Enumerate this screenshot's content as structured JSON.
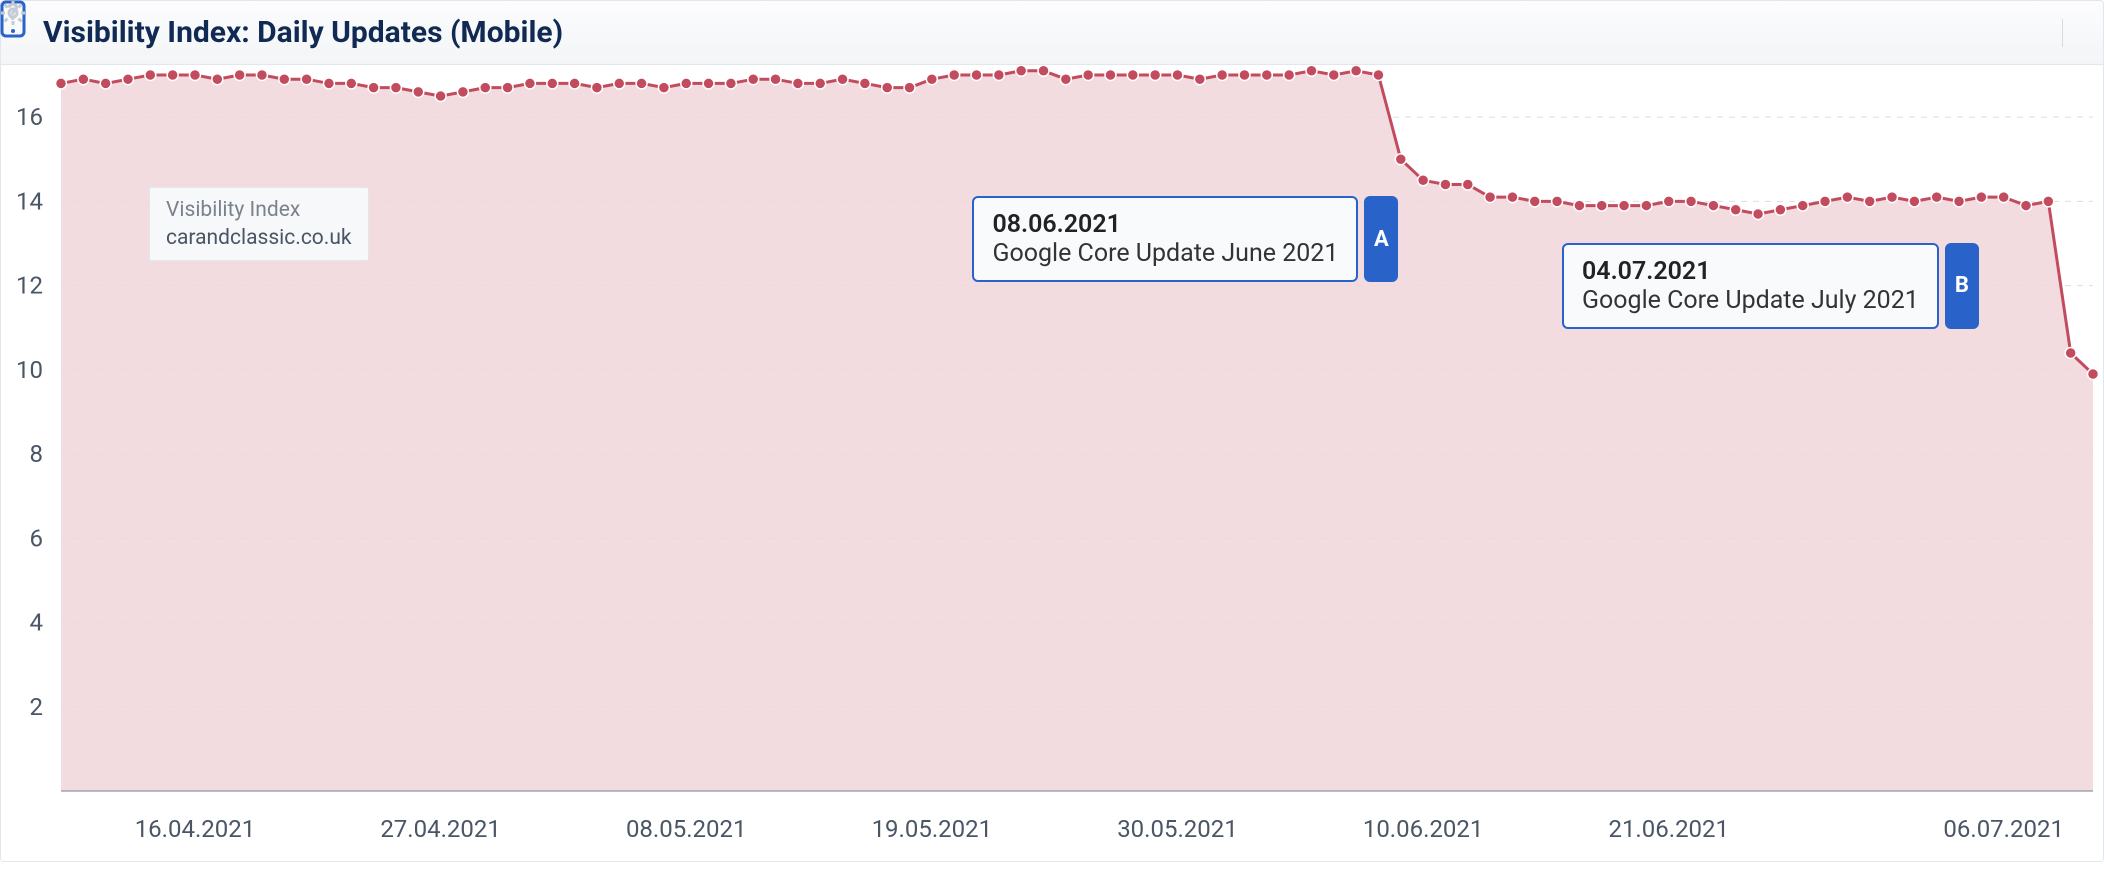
{
  "header": {
    "title": "Visibility Index: Daily Updates (Mobile)"
  },
  "legend": {
    "title": "Visibility Index",
    "domain": "carandclassic.co.uk"
  },
  "annotations": {
    "a": {
      "date": "08.06.2021",
      "text": "Google Core Update June 2021",
      "badge": "A"
    },
    "b": {
      "date": "04.07.2021",
      "text": "Google Core Update July 2021",
      "badge": "B"
    }
  },
  "chart_data": {
    "type": "area",
    "title": "Visibility Index: Daily Updates (Mobile)",
    "ylabel": "",
    "xlabel": "",
    "ylim": [
      0,
      17
    ],
    "y_ticks": [
      2,
      4,
      6,
      8,
      10,
      12,
      14,
      16
    ],
    "x_tick_labels": [
      "16.04.2021",
      "27.04.2021",
      "08.05.2021",
      "19.05.2021",
      "30.05.2021",
      "10.06.2021",
      "21.06.2021",
      "06.07.2021"
    ],
    "series": [
      {
        "name": "carandclassic.co.uk",
        "color": "#c24b5e",
        "fill": "#f0d6da",
        "x": [
          "10.04.2021",
          "11.04.2021",
          "12.04.2021",
          "13.04.2021",
          "14.04.2021",
          "15.04.2021",
          "16.04.2021",
          "17.04.2021",
          "18.04.2021",
          "19.04.2021",
          "20.04.2021",
          "21.04.2021",
          "22.04.2021",
          "23.04.2021",
          "24.04.2021",
          "25.04.2021",
          "26.04.2021",
          "27.04.2021",
          "28.04.2021",
          "29.04.2021",
          "30.04.2021",
          "01.05.2021",
          "02.05.2021",
          "03.05.2021",
          "04.05.2021",
          "05.05.2021",
          "06.05.2021",
          "07.05.2021",
          "08.05.2021",
          "09.05.2021",
          "10.05.2021",
          "11.05.2021",
          "12.05.2021",
          "13.05.2021",
          "14.05.2021",
          "15.05.2021",
          "16.05.2021",
          "17.05.2021",
          "18.05.2021",
          "19.05.2021",
          "20.05.2021",
          "21.05.2021",
          "22.05.2021",
          "23.05.2021",
          "24.05.2021",
          "25.05.2021",
          "26.05.2021",
          "27.05.2021",
          "28.05.2021",
          "29.05.2021",
          "30.05.2021",
          "31.05.2021",
          "01.06.2021",
          "02.06.2021",
          "03.06.2021",
          "04.06.2021",
          "05.06.2021",
          "06.06.2021",
          "07.06.2021",
          "08.06.2021",
          "09.06.2021",
          "10.06.2021",
          "11.06.2021",
          "12.06.2021",
          "13.06.2021",
          "14.06.2021",
          "15.06.2021",
          "16.06.2021",
          "17.06.2021",
          "18.06.2021",
          "19.06.2021",
          "20.06.2021",
          "21.06.2021",
          "22.06.2021",
          "23.06.2021",
          "24.06.2021",
          "25.06.2021",
          "26.06.2021",
          "27.06.2021",
          "28.06.2021",
          "29.06.2021",
          "30.06.2021",
          "01.07.2021",
          "02.07.2021",
          "03.07.2021",
          "04.07.2021",
          "05.07.2021",
          "06.07.2021",
          "07.07.2021",
          "08.07.2021",
          "09.07.2021",
          "10.07.2021"
        ],
        "values": [
          16.8,
          16.9,
          16.8,
          16.9,
          17.0,
          17.0,
          17.0,
          16.9,
          17.0,
          17.0,
          16.9,
          16.9,
          16.8,
          16.8,
          16.7,
          16.7,
          16.6,
          16.5,
          16.6,
          16.7,
          16.7,
          16.8,
          16.8,
          16.8,
          16.7,
          16.8,
          16.8,
          16.7,
          16.8,
          16.8,
          16.8,
          16.9,
          16.9,
          16.8,
          16.8,
          16.9,
          16.8,
          16.7,
          16.7,
          16.9,
          17.0,
          17.0,
          17.0,
          17.1,
          17.1,
          16.9,
          17.0,
          17.0,
          17.0,
          17.0,
          17.0,
          16.9,
          17.0,
          17.0,
          17.0,
          17.0,
          17.1,
          17.0,
          17.1,
          17.0,
          15.0,
          14.5,
          14.4,
          14.4,
          14.1,
          14.1,
          14.0,
          14.0,
          13.9,
          13.9,
          13.9,
          13.9,
          14.0,
          14.0,
          13.9,
          13.8,
          13.7,
          13.8,
          13.9,
          14.0,
          14.1,
          14.0,
          14.1,
          14.0,
          14.1,
          14.0,
          14.1,
          14.1,
          13.9,
          14.0,
          10.4,
          9.9
        ]
      }
    ],
    "annotations": [
      {
        "id": "A",
        "x": "08.06.2021",
        "label": "Google Core Update June 2021"
      },
      {
        "id": "B",
        "x": "04.07.2021",
        "label": "Google Core Update July 2021"
      }
    ]
  }
}
